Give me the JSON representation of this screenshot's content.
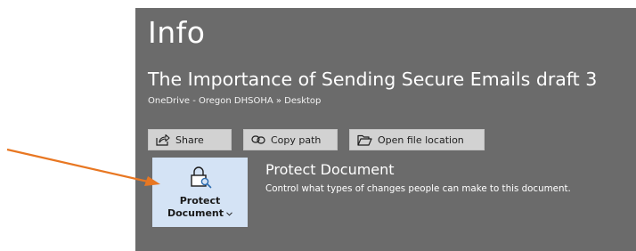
{
  "info": {
    "title": "Info"
  },
  "document": {
    "title": "The Importance of Sending Secure Emails draft 3",
    "location": "OneDrive - Oregon DHSOHA » Desktop"
  },
  "actions": {
    "share_label": "Share",
    "copy_path_label": "Copy path",
    "open_location_label": "Open file location"
  },
  "protect": {
    "button_line1": "Protect",
    "button_line2": "Document",
    "heading": "Protect Document",
    "description": "Control what types of changes people can make to this document."
  },
  "colors": {
    "panel_bg": "#6b6b6b",
    "button_bg": "#d2d2d2",
    "protect_tile_bg": "#d4e3f5",
    "annotation_arrow": "#e87722"
  },
  "icons": [
    "share-icon",
    "copy-path-icon",
    "folder-open-icon",
    "lock-icon",
    "chevron-down-icon"
  ]
}
